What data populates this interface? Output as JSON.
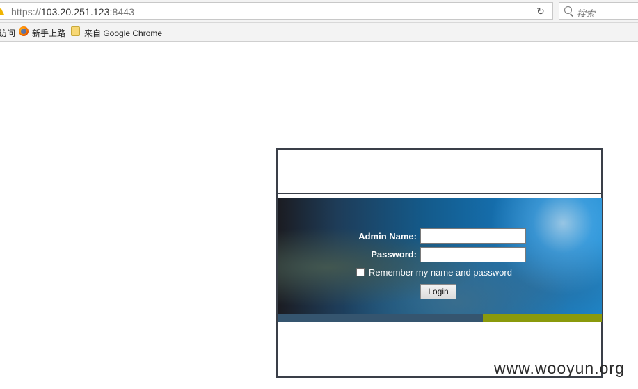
{
  "browser": {
    "url_scheme": "https://",
    "url_host": "103.20.251.123",
    "url_port": ":8443",
    "reload_glyph": "↻",
    "search_placeholder": "搜索"
  },
  "bookmarks": [
    {
      "label": "访问",
      "icon": "none"
    },
    {
      "label": "新手上路",
      "icon": "firefox-icon"
    },
    {
      "label": "来自 Google Chrome",
      "icon": "folder-icon"
    }
  ],
  "login": {
    "admin_name_label": "Admin Name:",
    "password_label": "Password:",
    "remember_label": "Remember my name and password",
    "login_button": "Login",
    "admin_name_value": "",
    "password_value": ""
  },
  "watermark": "www.wooyun.org",
  "colors": {
    "frame_border": "#3a3f48",
    "stripe_left": "#35556f",
    "stripe_right": "#8a9a0c",
    "banner_blue": "#1570b0"
  }
}
